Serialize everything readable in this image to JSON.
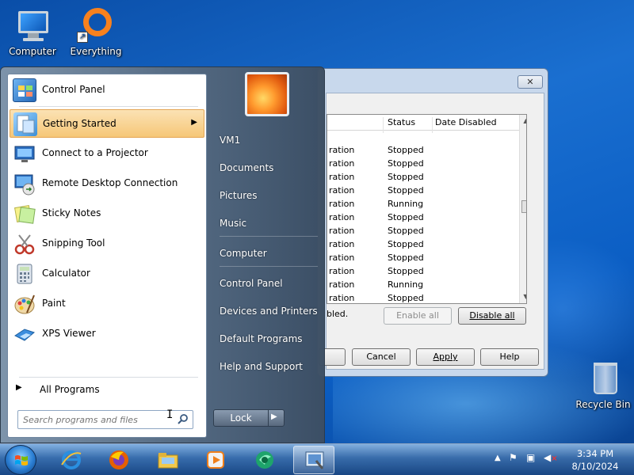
{
  "desktop": {
    "icons": [
      {
        "label": "Computer"
      },
      {
        "label": "Everything"
      },
      {
        "label": "Recycle Bin"
      }
    ]
  },
  "dialog": {
    "close_label": "✕",
    "columns": [
      "Status",
      "Date Disabled"
    ],
    "rows": [
      {
        "name": "ration",
        "status": "Stopped"
      },
      {
        "name": "ration",
        "status": "Stopped"
      },
      {
        "name": "ration",
        "status": "Stopped"
      },
      {
        "name": "ration",
        "status": "Stopped"
      },
      {
        "name": "ration",
        "status": "Running"
      },
      {
        "name": "ration",
        "status": "Stopped"
      },
      {
        "name": "ration",
        "status": "Stopped"
      },
      {
        "name": "ration",
        "status": "Stopped"
      },
      {
        "name": "ration",
        "status": "Stopped"
      },
      {
        "name": "ration",
        "status": "Stopped"
      },
      {
        "name": "ration",
        "status": "Running"
      },
      {
        "name": "ration",
        "status": "Stopped"
      }
    ],
    "note": "bled.",
    "enable_all": "Enable all",
    "disable_all": "Disable all",
    "cancel": "Cancel",
    "apply": "Apply",
    "help": "Help"
  },
  "start_menu": {
    "programs": [
      {
        "label": "Control Panel",
        "icon": "control-panel-icon"
      },
      {
        "label": "Getting Started",
        "icon": "getting-started-icon",
        "highlighted": true
      },
      {
        "label": "Connect to a Projector",
        "icon": "projector-icon"
      },
      {
        "label": "Remote Desktop Connection",
        "icon": "remote-desktop-icon"
      },
      {
        "label": "Sticky Notes",
        "icon": "sticky-notes-icon"
      },
      {
        "label": "Snipping Tool",
        "icon": "scissors-icon"
      },
      {
        "label": "Calculator",
        "icon": "calculator-icon"
      },
      {
        "label": "Paint",
        "icon": "paint-icon"
      },
      {
        "label": "XPS Viewer",
        "icon": "xps-viewer-icon"
      }
    ],
    "all_programs": "All Programs",
    "search_placeholder": "Search programs and files",
    "right_items": [
      {
        "label": "VM1"
      },
      {
        "label": "Documents"
      },
      {
        "label": "Pictures"
      },
      {
        "label": "Music"
      },
      {
        "label": "Computer"
      },
      {
        "label": "Control Panel"
      },
      {
        "label": "Devices and Printers"
      },
      {
        "label": "Default Programs"
      },
      {
        "label": "Help and Support"
      }
    ],
    "lock_label": "Lock"
  },
  "taskbar": {
    "apps": [
      "internet-explorer-icon",
      "firefox-icon",
      "file-explorer-icon",
      "media-player-icon",
      "network-app-icon",
      "msconfig-icon"
    ],
    "time": "3:34 PM",
    "date": "8/10/2024"
  },
  "colors": {
    "highlight": "#f6c778",
    "desktop": "#1a6fd0"
  }
}
